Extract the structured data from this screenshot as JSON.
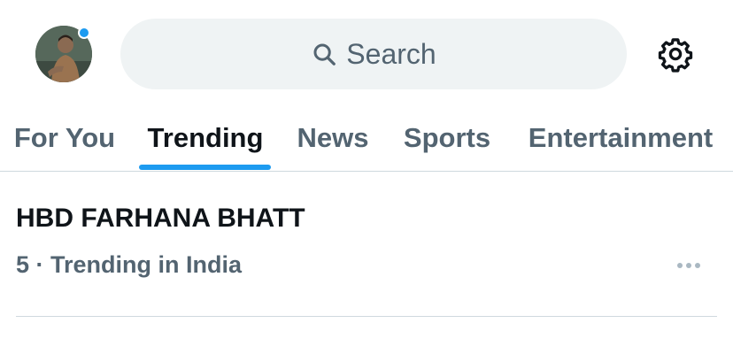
{
  "header": {
    "search_placeholder": "Search",
    "avatar_icon": "profile-avatar",
    "notification_dot_color": "#1d9bf0",
    "settings_icon": "gear-icon"
  },
  "tabs": [
    {
      "label": "For You",
      "active": false
    },
    {
      "label": "Trending",
      "active": true
    },
    {
      "label": "News",
      "active": false
    },
    {
      "label": "Sports",
      "active": false
    },
    {
      "label": "Entertainment",
      "active": false
    }
  ],
  "trends": [
    {
      "title": "HBD FARHANA BHATT",
      "meta": "5 · Trending in India",
      "more_icon": "more-horizontal-icon"
    }
  ],
  "colors": {
    "accent": "#1d9bf0",
    "text_primary": "#0f1419",
    "text_secondary": "#536471",
    "search_bg": "#eff3f4",
    "divider": "#cfd9de"
  }
}
